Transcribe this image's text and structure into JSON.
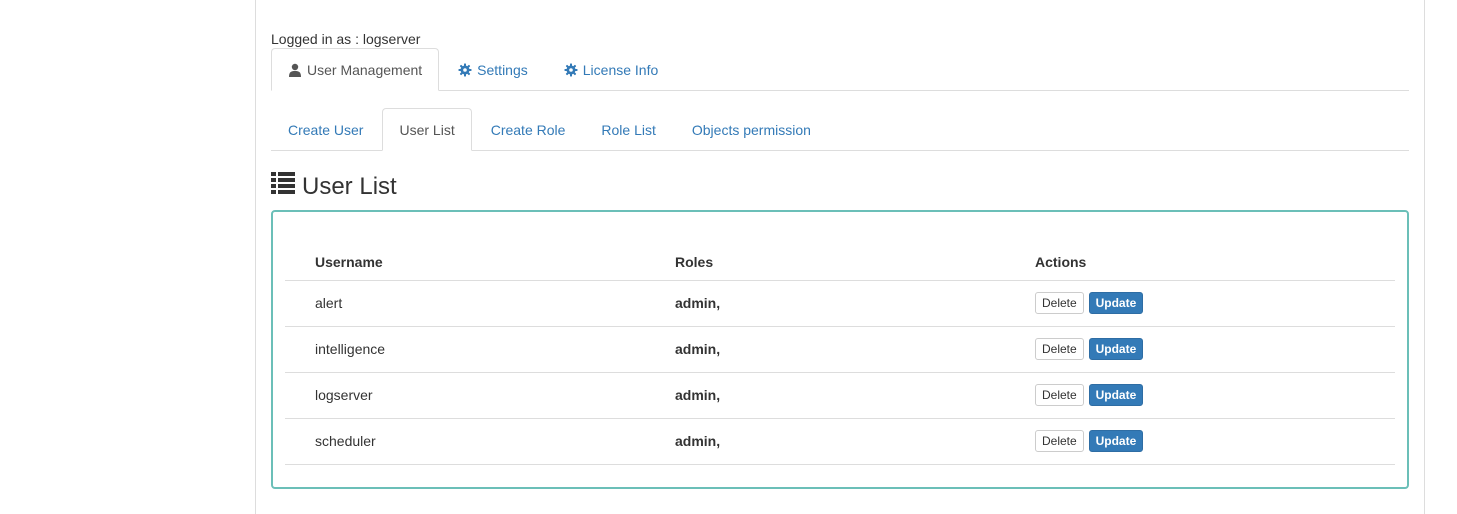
{
  "session": {
    "logged_in_text": "Logged in as : logserver"
  },
  "top_tabs": [
    {
      "label": "User Management",
      "icon": "user-icon",
      "active": true
    },
    {
      "label": "Settings",
      "icon": "gear-icon",
      "active": false
    },
    {
      "label": "License Info",
      "icon": "gear-icon",
      "active": false
    }
  ],
  "sub_tabs": [
    {
      "label": "Create User",
      "active": false
    },
    {
      "label": "User List",
      "active": true
    },
    {
      "label": "Create Role",
      "active": false
    },
    {
      "label": "Role List",
      "active": false
    },
    {
      "label": "Objects permission",
      "active": false
    }
  ],
  "main": {
    "title": "User List",
    "title_icon": "list-icon",
    "table": {
      "headers": {
        "username": "Username",
        "roles": "Roles",
        "actions": "Actions"
      },
      "rows": [
        {
          "username": "alert",
          "roles": "admin,"
        },
        {
          "username": "intelligence",
          "roles": "admin,"
        },
        {
          "username": "logserver",
          "roles": "admin,"
        },
        {
          "username": "scheduler",
          "roles": "admin,"
        }
      ],
      "delete_label": "Delete",
      "update_label": "Update"
    }
  },
  "colors": {
    "link": "#337ab7",
    "panel_border": "#6bbfb8",
    "primary_button": "#337ab7"
  }
}
